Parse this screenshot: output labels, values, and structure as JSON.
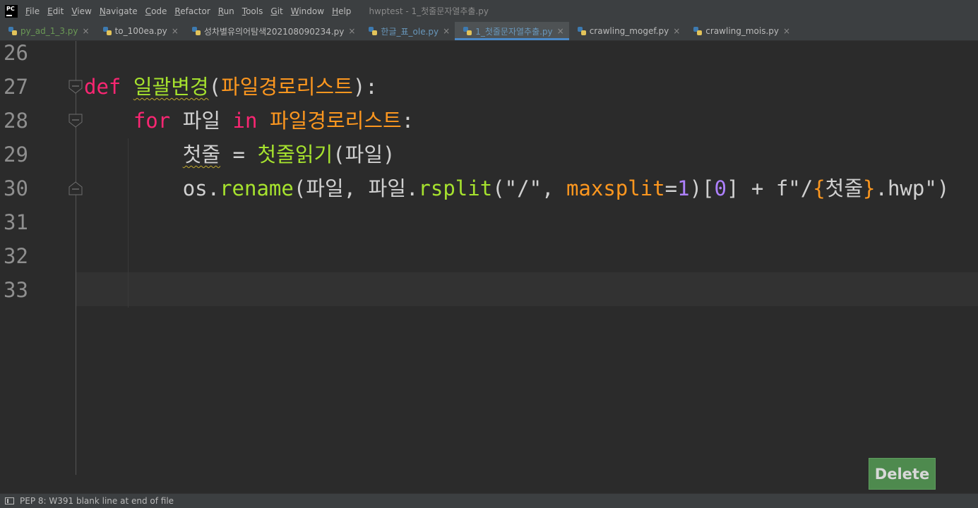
{
  "app": {
    "logo_text": "PC",
    "window_title": "hwptest - 1_첫줄문자열추출.py"
  },
  "menu": [
    {
      "mn": "F",
      "rest": "ile"
    },
    {
      "mn": "E",
      "rest": "dit"
    },
    {
      "mn": "V",
      "rest": "iew"
    },
    {
      "mn": "N",
      "rest": "avigate"
    },
    {
      "mn": "C",
      "rest": "ode"
    },
    {
      "mn": "R",
      "rest": "efactor"
    },
    {
      "mn": "R",
      "rest": "un"
    },
    {
      "mn": "T",
      "rest": "ools"
    },
    {
      "mn": "G",
      "rest": "it"
    },
    {
      "mn": "W",
      "rest": "indow"
    },
    {
      "mn": "H",
      "rest": "elp"
    }
  ],
  "tabs": [
    {
      "label": "py_ad_1_3.py",
      "color": "#6a9955",
      "active": false
    },
    {
      "label": "to_100ea.py",
      "color": "#bbbbbb",
      "active": false
    },
    {
      "label": "성차별유의어탐색202108090234.py",
      "color": "#bbbbbb",
      "active": false
    },
    {
      "label": "한글_표_ole.py",
      "color": "#6897bb",
      "active": false
    },
    {
      "label": "1_첫줄문자열추출.py",
      "color": "#6897bb",
      "active": true
    },
    {
      "label": "crawling_mogef.py",
      "color": "#bbbbbb",
      "active": false
    },
    {
      "label": "crawling_mois.py",
      "color": "#bbbbbb",
      "active": false
    }
  ],
  "tab_close_glyph": "×",
  "editor": {
    "line_numbers": [
      "26",
      "27",
      "28",
      "29",
      "30",
      "31",
      "32",
      "33"
    ],
    "line27": {
      "kw": "def",
      "fn": "일괄변경",
      "open": "(",
      "param": "파일경로리스트",
      "close": "):"
    },
    "line28": {
      "kw_for": "for",
      "var": "파일",
      "kw_in": "in",
      "param": "파일경로리스트",
      "colon": ":"
    },
    "line29": {
      "var": "첫줄",
      "eq": " = ",
      "fn": "첫줄읽기",
      "args": "(파일)"
    },
    "line30": {
      "obj": "os",
      "dot1": ".",
      "fn1": "rename",
      "p1": "(파일, 파일",
      "dot2": ".",
      "fn2": "rsplit",
      "p2": "(\"/\", ",
      "kwarg": "maxsplit",
      "eq": "=",
      "num1": "1",
      "p3": ")[",
      "num0": "0",
      "p4": "] + ",
      "fprefix": "f\"/",
      "brace_open": "{",
      "interp": "첫줄",
      "brace_close": "}",
      "fsuffix": ".hwp\")"
    }
  },
  "status": {
    "text": "PEP 8: W391 blank line at end of file"
  },
  "delete_button": {
    "label": "Delete"
  }
}
